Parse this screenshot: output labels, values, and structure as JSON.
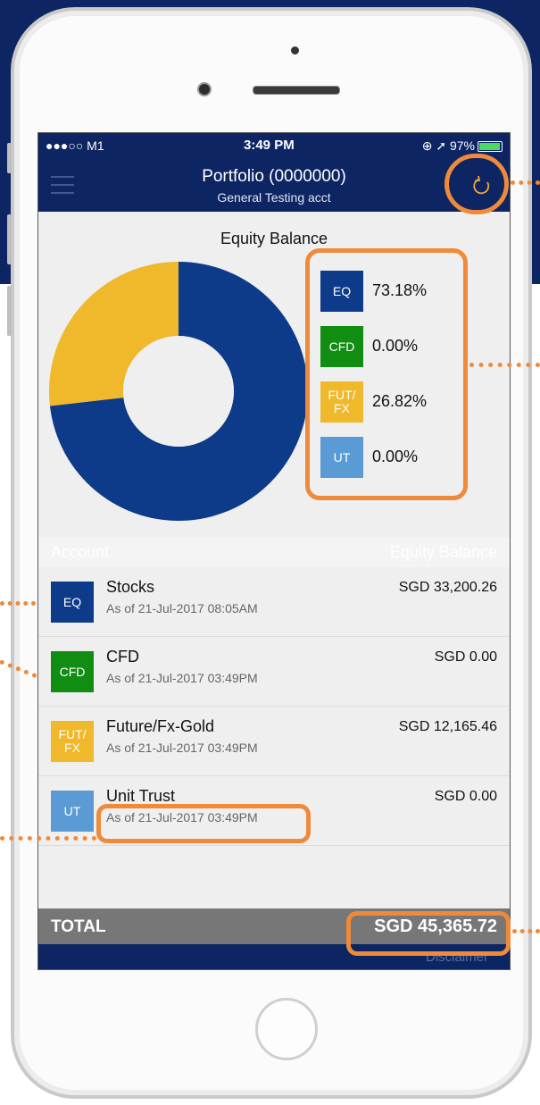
{
  "status_bar": {
    "carrier": "●●●○○ M1",
    "time": "3:49 PM",
    "right": "⊕ ➚ 97%"
  },
  "nav": {
    "title": "Portfolio (0000000)",
    "subtitle": "General Testing acct",
    "refresh_icon": "refresh-icon"
  },
  "chart_data": {
    "type": "pie",
    "title": "Equity Balance",
    "donut": true,
    "slices": [
      {
        "label": "EQ",
        "value": 73.18,
        "color": "#0d3b8a"
      },
      {
        "label": "CFD",
        "value": 0.0,
        "color": "#118e11"
      },
      {
        "label": "FUT/FX",
        "value": 26.82,
        "color": "#f0b82b"
      },
      {
        "label": "UT",
        "value": 0.0,
        "color": "#5b9bd5"
      }
    ]
  },
  "legend": [
    {
      "label": "EQ",
      "value": "73.18%",
      "color": "#0d3b8a"
    },
    {
      "label": "CFD",
      "value": "0.00%",
      "color": "#118e11"
    },
    {
      "label": "FUT/ FX",
      "value": "26.82%",
      "color": "#f0b82b"
    },
    {
      "label": "UT",
      "value": "0.00%",
      "color": "#5b9bd5"
    }
  ],
  "table": {
    "header_left": "Account",
    "header_right": "Equity Balance",
    "rows": [
      {
        "icon": "EQ",
        "color": "#0d3b8a",
        "name": "Stocks",
        "date": "As of 21-Jul-2017 08:05AM",
        "amount": "SGD 33,200.26"
      },
      {
        "icon": "CFD",
        "color": "#118e11",
        "name": "CFD",
        "date": "As of 21-Jul-2017 03:49PM",
        "amount": "SGD 0.00"
      },
      {
        "icon": "FUT/ FX",
        "color": "#f0b82b",
        "name": "Future/Fx-Gold",
        "date": "As of 21-Jul-2017 03:49PM",
        "amount": "SGD 12,165.46"
      },
      {
        "icon": "UT",
        "color": "#5b9bd5",
        "name": "Unit Trust",
        "date": "As of 21-Jul-2017 03:49PM",
        "amount": "SGD 0.00"
      }
    ]
  },
  "total": {
    "label": "TOTAL",
    "value": "SGD 45,365.72"
  },
  "footer": {
    "disclaimer": "Disclaimer"
  },
  "colors": {
    "navy": "#0d2563",
    "annotation": "#ef8a3a"
  }
}
